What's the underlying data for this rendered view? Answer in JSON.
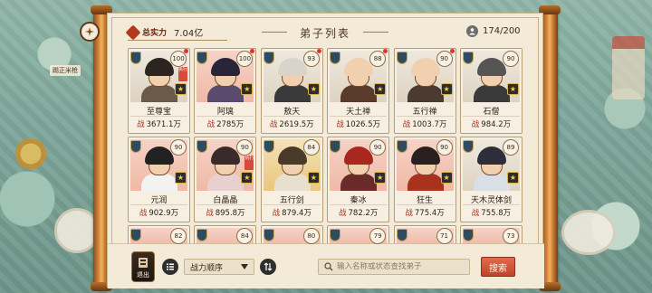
{
  "header": {
    "power_label": "总实力",
    "power_value": "7.04亿",
    "title": "弟子列表",
    "count": "174/200"
  },
  "map": {
    "label": "踢正米枪"
  },
  "disciples": [
    {
      "name": "至尊宝",
      "power": "3671.1万",
      "level": "100",
      "bg": "white",
      "hair": "#2b2420",
      "robe": "#6b5a4a",
      "status": "执行",
      "dot": true
    },
    {
      "name": "阿璃",
      "power": "2785万",
      "level": "100",
      "bg": "pink",
      "hair": "#2a2438",
      "robe": "#5a4a6e",
      "dot": true
    },
    {
      "name": "敖天",
      "power": "2619.5万",
      "level": "93",
      "bg": "white",
      "hair": "#d8d4cc",
      "robe": "#3a3a3a",
      "dot": true
    },
    {
      "name": "天土禅",
      "power": "1026.5万",
      "level": "88",
      "bg": "white",
      "hair": "#f1d0b0",
      "robe": "#5a3a2a",
      "dot": true
    },
    {
      "name": "五行禅",
      "power": "1003.7万",
      "level": "90",
      "bg": "white",
      "hair": "#f1d0b0",
      "robe": "#4a3a30",
      "dot": true
    },
    {
      "name": "石僧",
      "power": "984.2万",
      "level": "90",
      "bg": "white",
      "hair": "#555555",
      "robe": "#3a3a3a",
      "dot": false
    },
    {
      "name": "元润",
      "power": "902.9万",
      "level": "90",
      "bg": "pink",
      "hair": "#222222",
      "robe": "#f2f2f2",
      "dot": false
    },
    {
      "name": "白晶晶",
      "power": "895.8万",
      "level": "90",
      "bg": "pink",
      "hair": "#3a2a2a",
      "robe": "#e8cfd0",
      "status": "执行",
      "dot": false
    },
    {
      "name": "五行剑",
      "power": "879.4万",
      "level": "84",
      "bg": "gold",
      "hair": "#4a3a2a",
      "robe": "#e9dfcf",
      "dot": false
    },
    {
      "name": "秦冰",
      "power": "782.2万",
      "level": "90",
      "bg": "pink",
      "hair": "#a8271e",
      "robe": "#6a2a2a",
      "dot": false
    },
    {
      "name": "狂生",
      "power": "775.4万",
      "level": "90",
      "bg": "pink",
      "hair": "#2a2020",
      "robe": "#a8321e",
      "dot": false
    },
    {
      "name": "天木灵体剑",
      "power": "755.8万",
      "level": "89",
      "bg": "white",
      "hair": "#2e2e3a",
      "robe": "#d9dfe6",
      "dot": false
    }
  ],
  "partial_row": [
    {
      "level": "82",
      "bg": "pink"
    },
    {
      "level": "84",
      "bg": "pink"
    },
    {
      "level": "80",
      "bg": "pink"
    },
    {
      "level": "79",
      "bg": "pink"
    },
    {
      "level": "71",
      "bg": "pink"
    },
    {
      "level": "73",
      "bg": "pink"
    }
  ],
  "power_prefix": "战",
  "star_glyph": "★",
  "bottom": {
    "retreat_label": "退出",
    "sort_label": "战力顺序",
    "search_placeholder": "输入名称或状态查找弟子",
    "search_button": "搜索"
  },
  "colors": {
    "accent_red": "#c0432a",
    "paper": "#f3ead8",
    "rod": "#d88a3c"
  }
}
